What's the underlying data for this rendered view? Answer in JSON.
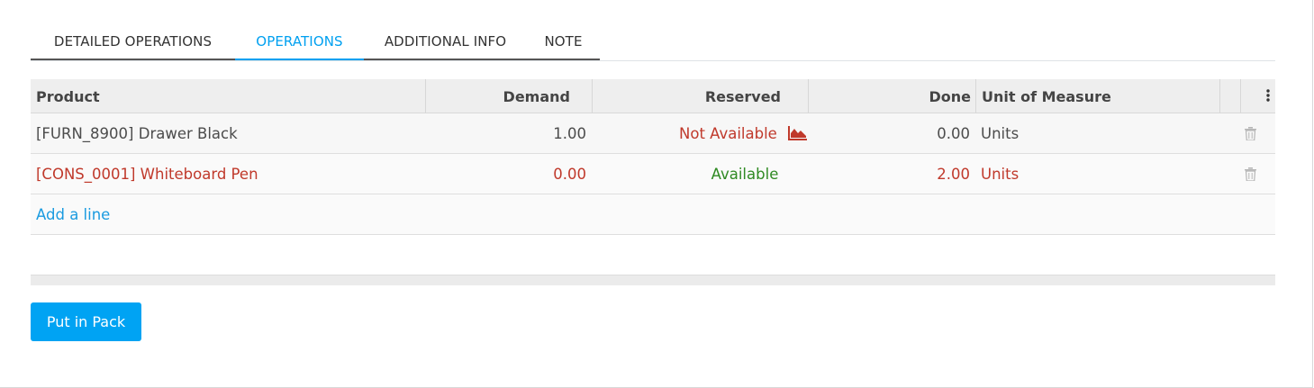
{
  "tabs": [
    {
      "label": "DETAILED OPERATIONS",
      "active": false
    },
    {
      "label": "OPERATIONS",
      "active": true
    },
    {
      "label": "ADDITIONAL INFO",
      "active": false
    },
    {
      "label": "NOTE",
      "active": false
    }
  ],
  "table": {
    "headers": {
      "product": "Product",
      "demand": "Demand",
      "reserved": "Reserved",
      "done": "Done",
      "uom": "Unit of Measure"
    },
    "rows": [
      {
        "product": "[FURN_8900] Drawer Black",
        "demand": "1.00",
        "reserved": "Not Available",
        "done": "0.00",
        "uom": "Units",
        "highlight": false
      },
      {
        "product": "[CONS_0001] Whiteboard Pen",
        "demand": "0.00",
        "reserved": "Available",
        "done": "2.00",
        "uom": "Units",
        "highlight": true
      }
    ],
    "add_line": "Add a line"
  },
  "icons": {
    "kebab": "vertical-ellipsis-icon",
    "trash": "trash-icon",
    "forecast": "area-chart-icon"
  },
  "colors": {
    "accent": "#00a0f0",
    "danger": "#c0392b",
    "success": "#2f8a23",
    "button": "#00a3f3"
  },
  "actions": {
    "put_in_pack": "Put in Pack"
  }
}
